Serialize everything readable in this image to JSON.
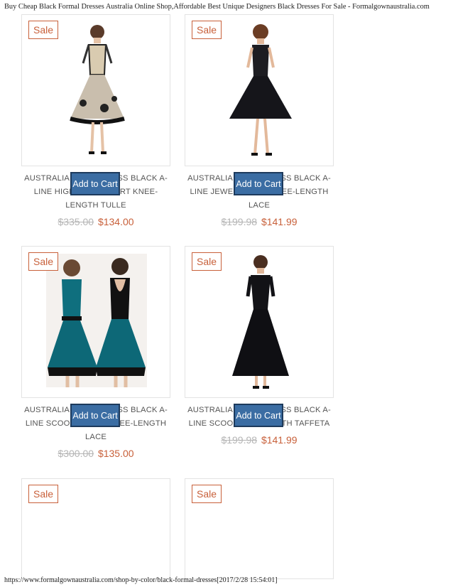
{
  "header": {
    "title": "Buy Cheap Black Formal Dresses Australia Online Shop,Affordable Best Unique Designers Black Dresses For Sale - Formalgownaustralia.com"
  },
  "footer": {
    "url": "https://www.formalgownaustralia.com/shop-by-color/black-formal-dresses[2017/2/28 15:54:01]"
  },
  "products": [
    {
      "badge": "Sale",
      "title": "AUSTRALIA PARTY DRESS BLACK A-LINE HIGH NECK SHORT KNEE-LENGTH TULLE",
      "button": "Add to Cart",
      "old_price": "$335.00",
      "new_price": "$134.00"
    },
    {
      "badge": "Sale",
      "title": "AUSTRALIA PARTY DRESS BLACK A-LINE JEWEL SHORT KNEE-LENGTH LACE",
      "button": "Add to Cart",
      "old_price": "$199.98",
      "new_price": "$141.99"
    },
    {
      "badge": "Sale",
      "title": "AUSTRALIA PARTY DRESS BLACK A-LINE SCOOP SHORT KNEE-LENGTH LACE",
      "button": "Add to Cart",
      "old_price": "$300.00",
      "new_price": "$135.00"
    },
    {
      "badge": "Sale",
      "title": "AUSTRALIA PARTY DRESS BLACK A-LINE SCOOP TEA-LENGTH TAFFETA",
      "button": "Add to Cart",
      "old_price": "$199.98",
      "new_price": "$141.99"
    },
    {
      "badge": "Sale"
    },
    {
      "badge": "Sale"
    }
  ],
  "colors": {
    "accent": "#c8603a",
    "button": "#3b6da3",
    "old_price": "#b5b5b5"
  }
}
